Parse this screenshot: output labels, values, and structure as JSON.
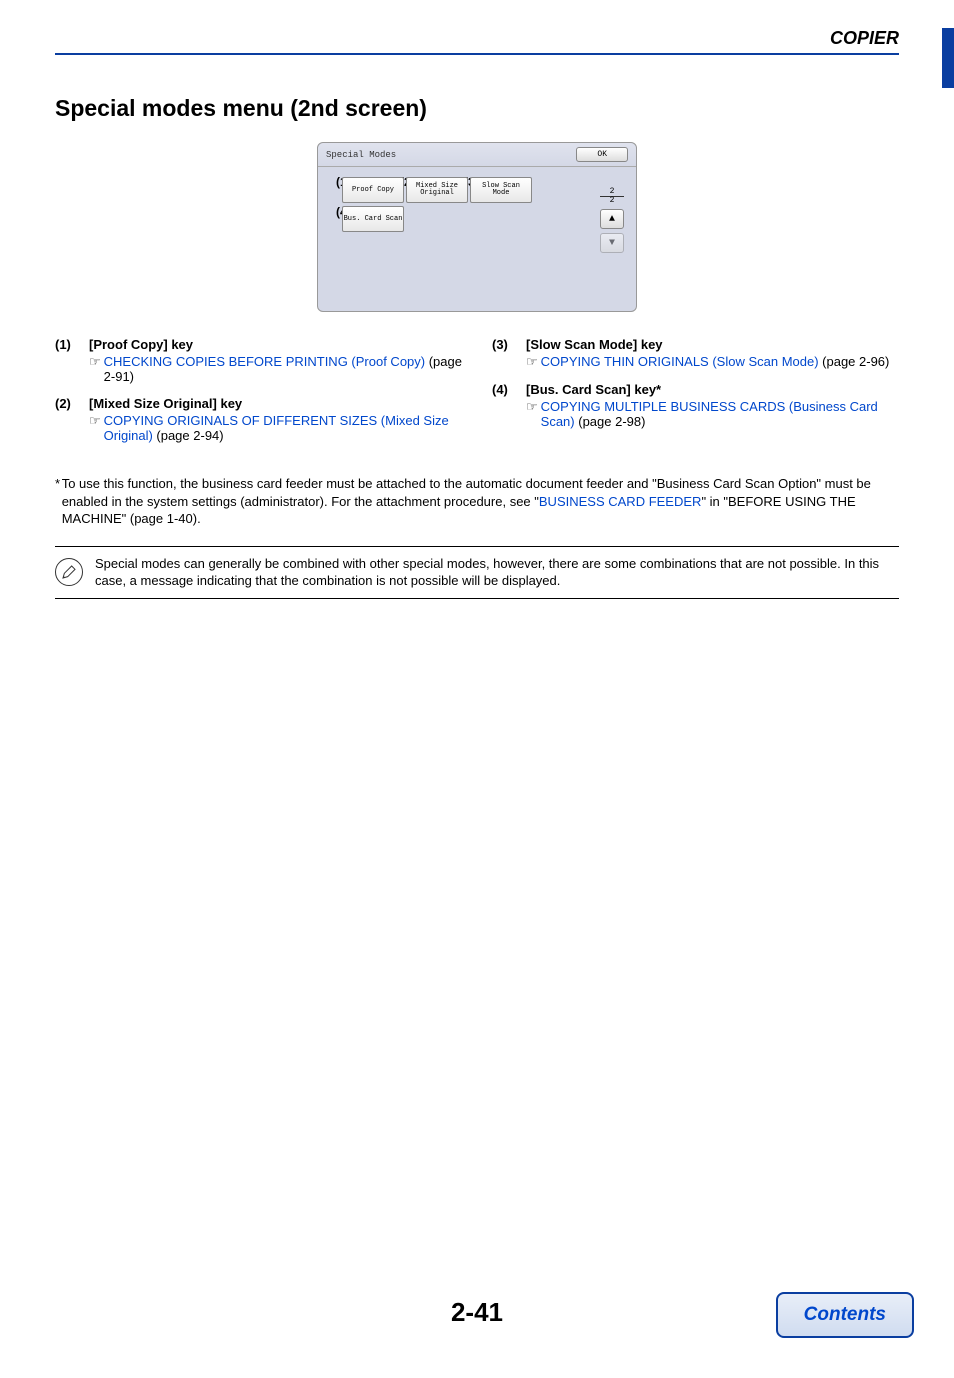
{
  "header": {
    "section": "COPIER"
  },
  "heading": "Special modes menu (2nd screen)",
  "ui": {
    "title": "Special Modes",
    "ok": "OK",
    "btns": {
      "b1": "Proof Copy",
      "b2a": "Mixed Size",
      "b2b": "Original",
      "b3a": "Slow Scan",
      "b3b": "Mode",
      "b4": "Bus. Card Scan"
    },
    "labels": {
      "n1": "(1)",
      "n2": "(2)",
      "n3": "(3)",
      "n4": "(4)"
    },
    "page_top": "2",
    "page_bottom": "2"
  },
  "items": {
    "i1": {
      "idx": "(1)",
      "title": "[Proof Copy] key",
      "link": "CHECKING COPIES BEFORE PRINTING (Proof Copy)",
      "tail": " (page 2-91)"
    },
    "i2": {
      "idx": "(2)",
      "title": "[Mixed Size Original] key",
      "link": "COPYING ORIGINALS OF DIFFERENT SIZES (Mixed Size Original)",
      "tail": " (page 2-94)"
    },
    "i3": {
      "idx": "(3)",
      "title": "[Slow Scan Mode] key",
      "link": "COPYING THIN ORIGINALS (Slow Scan Mode)",
      "tail": " (page 2-96)"
    },
    "i4": {
      "idx": "(4)",
      "title": "[Bus. Card Scan] key*",
      "link": "COPYING MULTIPLE BUSINESS CARDS (Business Card Scan)",
      "tail": " (page 2-98)"
    }
  },
  "footnote": {
    "star": "*",
    "pre": "To use this function, the business card feeder must be attached to the automatic document feeder and \"Business Card Scan Option\" must be enabled in the system settings (administrator). For the attachment procedure, see \"",
    "link": "BUSINESS CARD FEEDER",
    "post": "\" in \"BEFORE USING THE MACHINE\" (page 1-40)."
  },
  "note": "Special modes can generally be combined with other special modes, however, there are some combinations that are not possible. In this case, a message indicating that the combination is not possible will be displayed.",
  "page_number": "2-41",
  "contents": "Contents"
}
